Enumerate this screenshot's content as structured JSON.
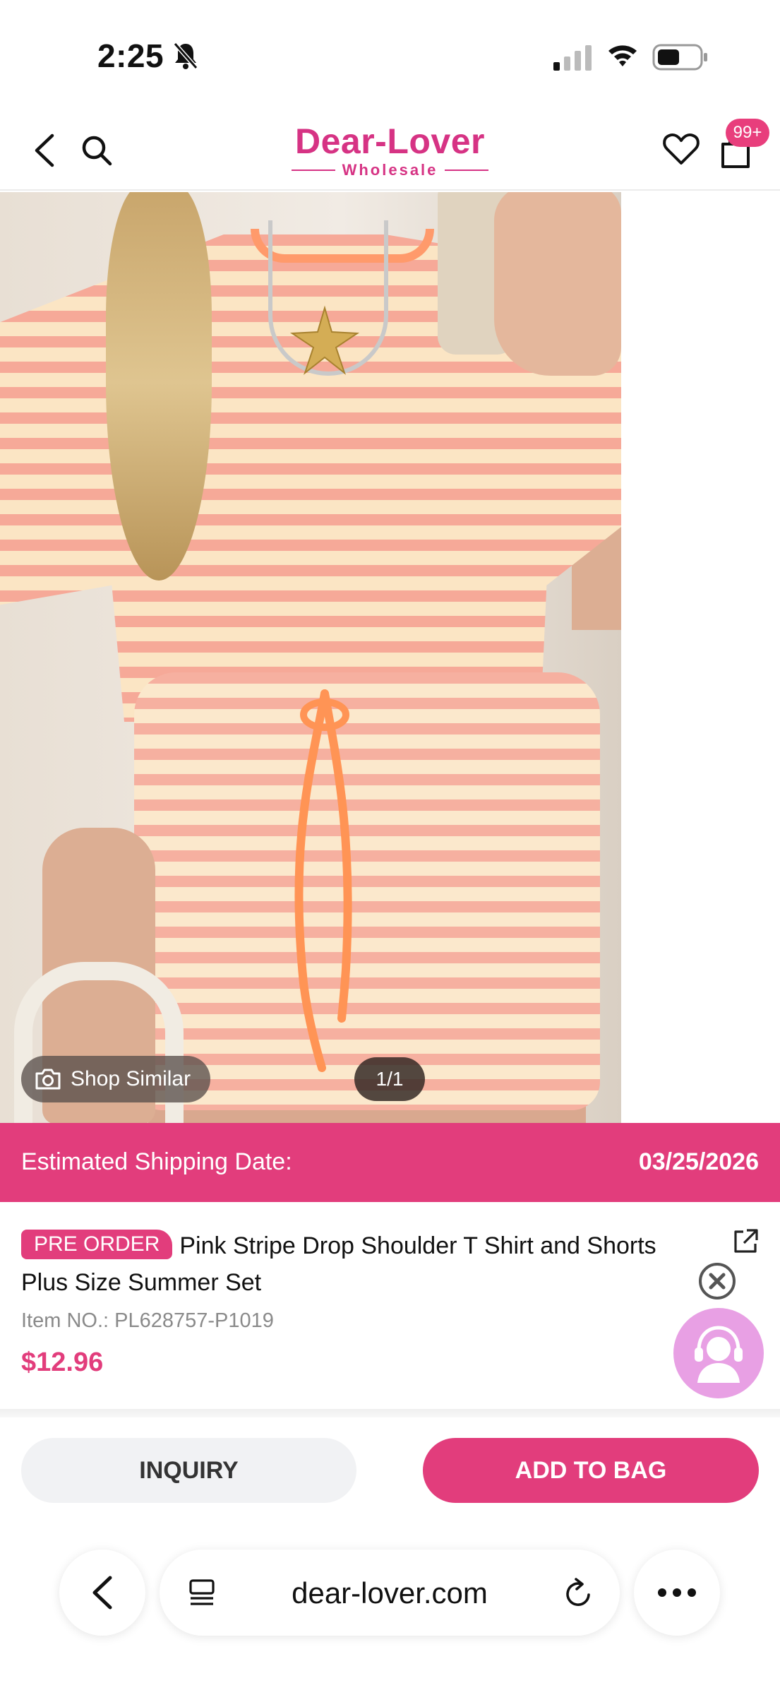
{
  "status_bar": {
    "time": "2:25",
    "icons": [
      "bell-slash-icon",
      "signal-icon",
      "wifi-icon",
      "battery-icon"
    ]
  },
  "header": {
    "logo_main": "Dear-Lover",
    "logo_sub": "Wholesale",
    "bag_badge": "99+",
    "icons": [
      "back-arrow-icon",
      "search-icon",
      "heart-icon",
      "bag-icon"
    ],
    "brand_color": "#d63384"
  },
  "gallery": {
    "shop_similar_label": "Shop Similar",
    "page_indicator": "1/1"
  },
  "shipping": {
    "label": "Estimated Shipping Date:",
    "date": "03/25/2026",
    "banner_color": "#e23d7c"
  },
  "product": {
    "badge": "PRE ORDER",
    "title": "Pink Stripe Drop Shoulder T Shirt and Shorts Plus Size Summer Set",
    "item_no": "Item NO.: PL628757-P1019",
    "price": "$12.96"
  },
  "actions": {
    "inquiry_label": "INQUIRY",
    "add_to_bag_label": "ADD TO BAG"
  },
  "browser": {
    "url": "dear-lover.com",
    "icons": [
      "chevron-left-icon",
      "tabs-icon",
      "reload-icon",
      "more-icon"
    ]
  }
}
